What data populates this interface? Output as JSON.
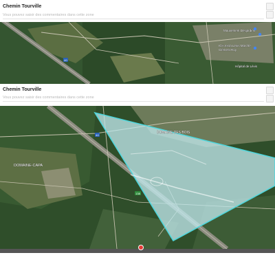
{
  "cards": [
    {
      "title": "Chemin Tourville",
      "comment_placeholder": "Vous pouvez saisir des commentaires dans cette zone",
      "map": {
        "labels": [
          {
            "text": "Mouvement Desjardins"
          },
          {
            "text": "IGA extra Lévis Marché"
          },
          {
            "text": "Clément Roy"
          },
          {
            "text": "Hôpital de Lévis"
          }
        ],
        "route_shield": "40"
      }
    },
    {
      "title": "Chemin Tourville",
      "comment_placeholder": "Vous pouvez saisir des commentaires dans cette zone",
      "map": {
        "labels": [
          {
            "text": "DOMAINE-CAPA"
          },
          {
            "text": "DOMAINE DES BOIS"
          }
        ],
        "route_shields": [
          "40",
          "138"
        ],
        "polygon": {
          "fill": "#bfe7ea",
          "stroke": "#4fd6dc"
        },
        "marker_color": "#e53935"
      }
    }
  ]
}
